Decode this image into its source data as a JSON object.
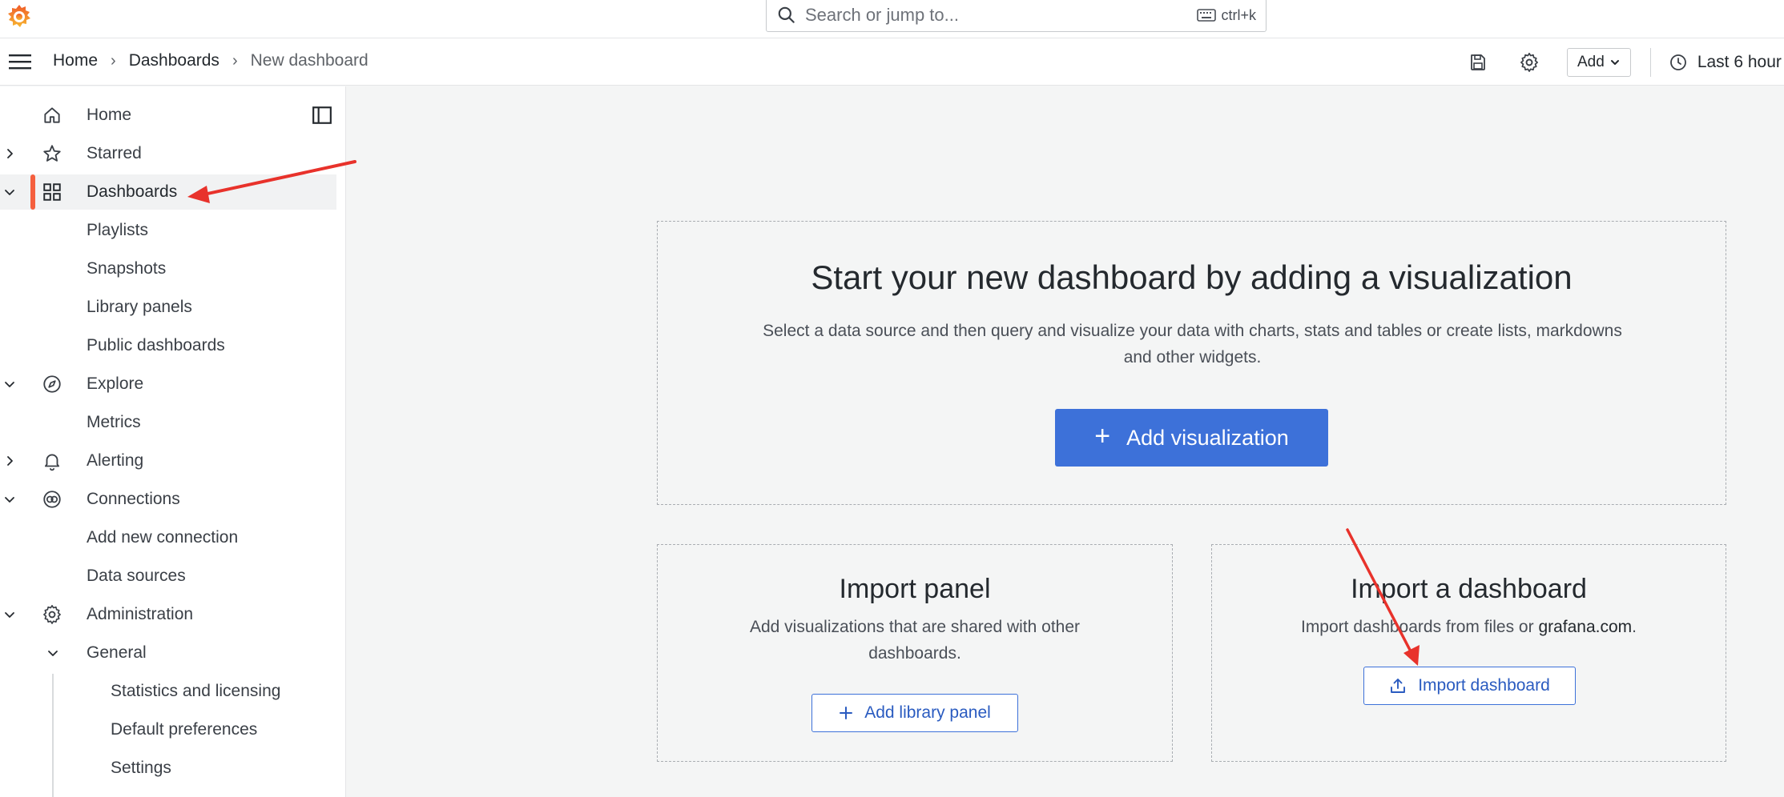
{
  "header": {
    "logo": "grafana-logo",
    "search": {
      "placeholder": "Search or jump to...",
      "shortcut": "ctrl+k"
    }
  },
  "breadcrumb": [
    {
      "label": "Home"
    },
    {
      "label": "Dashboards"
    },
    {
      "label": "New dashboard"
    }
  ],
  "toolbar": {
    "save_icon": "save-icon",
    "settings_icon": "gear-icon",
    "add_label": "Add",
    "time_range": "Last 6 hour"
  },
  "sidebar": {
    "items": [
      {
        "label": "Home",
        "icon": "home-icon"
      },
      {
        "label": "Starred",
        "icon": "star-icon",
        "chevron": "right"
      },
      {
        "label": "Dashboards",
        "icon": "grid-icon",
        "chevron": "down",
        "active": true
      },
      {
        "label": "Playlists"
      },
      {
        "label": "Snapshots"
      },
      {
        "label": "Library panels"
      },
      {
        "label": "Public dashboards"
      },
      {
        "label": "Explore",
        "icon": "compass-icon",
        "chevron": "down"
      },
      {
        "label": "Metrics"
      },
      {
        "label": "Alerting",
        "icon": "bell-icon",
        "chevron": "right"
      },
      {
        "label": "Connections",
        "icon": "connections-icon",
        "chevron": "down"
      },
      {
        "label": "Add new connection"
      },
      {
        "label": "Data sources"
      },
      {
        "label": "Administration",
        "icon": "gear-icon",
        "chevron": "down"
      },
      {
        "label": "General",
        "chevron": "down"
      },
      {
        "label": "Statistics and licensing"
      },
      {
        "label": "Default preferences"
      },
      {
        "label": "Settings"
      }
    ]
  },
  "main": {
    "hero": {
      "title": "Start your new dashboard by adding a visualization",
      "description": "Select a data source and then query and visualize your data with charts, stats and tables or create lists, markdowns and other widgets.",
      "button": "Add visualization"
    },
    "import_panel": {
      "title": "Import panel",
      "description": "Add visualizations that are shared with other dashboards.",
      "button": "Add library panel"
    },
    "import_dashboard": {
      "title": "Import a dashboard",
      "description_prefix": "Import dashboards from files or ",
      "description_link": "grafana.com",
      "description_suffix": ".",
      "button": "Import dashboard"
    }
  },
  "colors": {
    "accent": "#3d71d9",
    "active_indicator": "#f55f3e",
    "annotation_arrow": "#e8322b"
  }
}
